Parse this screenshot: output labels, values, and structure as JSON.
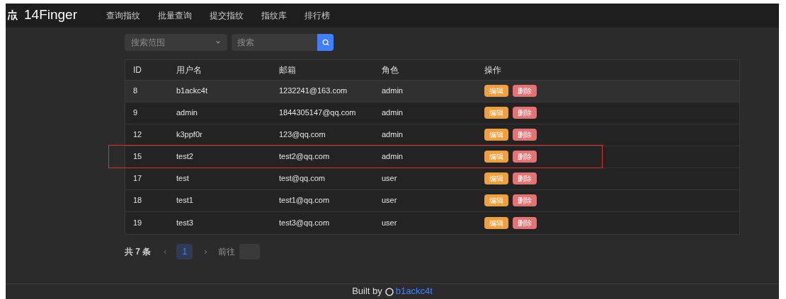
{
  "header": {
    "logo": "14Finger",
    "nav": [
      {
        "label": "查询指纹"
      },
      {
        "label": "批量查询"
      },
      {
        "label": "提交指纹"
      },
      {
        "label": "指纹库"
      },
      {
        "label": "排行榜"
      }
    ]
  },
  "search": {
    "scope_placeholder": "搜索范围",
    "placeholder": "搜索"
  },
  "table": {
    "columns": [
      "ID",
      "用户名",
      "邮箱",
      "角色",
      "操作"
    ],
    "rows": [
      {
        "id": "8",
        "username": "b1ackc4t",
        "email": "1232241@163.com",
        "role": "admin",
        "hovered": true,
        "highlighted": false,
        "actions": [
          "编辑",
          "删除"
        ]
      },
      {
        "id": "9",
        "username": "admin",
        "email": "1844305147@qq.com",
        "role": "admin",
        "hovered": false,
        "highlighted": false,
        "actions": [
          "编辑",
          "删除"
        ]
      },
      {
        "id": "12",
        "username": "k3ppf0r",
        "email": "123@qq.com",
        "role": "admin",
        "hovered": false,
        "highlighted": false,
        "actions": [
          "编辑",
          "删除"
        ]
      },
      {
        "id": "15",
        "username": "test2",
        "email": "test2@qq.com",
        "role": "admin",
        "hovered": false,
        "highlighted": true,
        "actions": [
          "编辑",
          "删除"
        ]
      },
      {
        "id": "17",
        "username": "test",
        "email": "test@qq.com",
        "role": "user",
        "hovered": false,
        "highlighted": false,
        "actions": [
          "编辑",
          "删除"
        ]
      },
      {
        "id": "18",
        "username": "test1",
        "email": "test1@qq.com",
        "role": "user",
        "hovered": false,
        "highlighted": false,
        "actions": [
          "编辑",
          "删除"
        ]
      },
      {
        "id": "19",
        "username": "test3",
        "email": "test3@qq.com",
        "role": "user",
        "hovered": false,
        "highlighted": false,
        "actions": [
          "编辑",
          "删除"
        ]
      }
    ]
  },
  "pagination": {
    "total": "共 7 条",
    "prev": "‹",
    "pages": [
      {
        "label": "1",
        "selected": true
      }
    ],
    "next": "›",
    "goto_label": "前往"
  },
  "footer": {
    "text": "Built by",
    "link": "b1ackc4t"
  }
}
